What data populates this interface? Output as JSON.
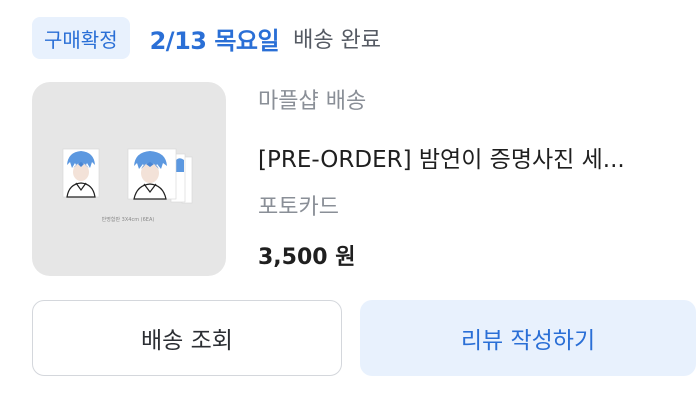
{
  "order": {
    "badge": "구매확정",
    "date": "2/13 목요일",
    "delivery_status": "배송 완료"
  },
  "product": {
    "seller": "마플샵 배송",
    "title": "[PRE-ORDER] 밤연이 증명사진 세...",
    "option": "포토카드",
    "price": "3,500 원",
    "thumbnail_caption": "반명함판 3X4cm (6EA)"
  },
  "actions": {
    "track_label": "배송 조회",
    "review_label": "리뷰 작성하기"
  },
  "colors": {
    "accent": "#2a6fd6",
    "accent_bg": "#e8f1fd",
    "thumb_bg": "#e6e6e6"
  }
}
